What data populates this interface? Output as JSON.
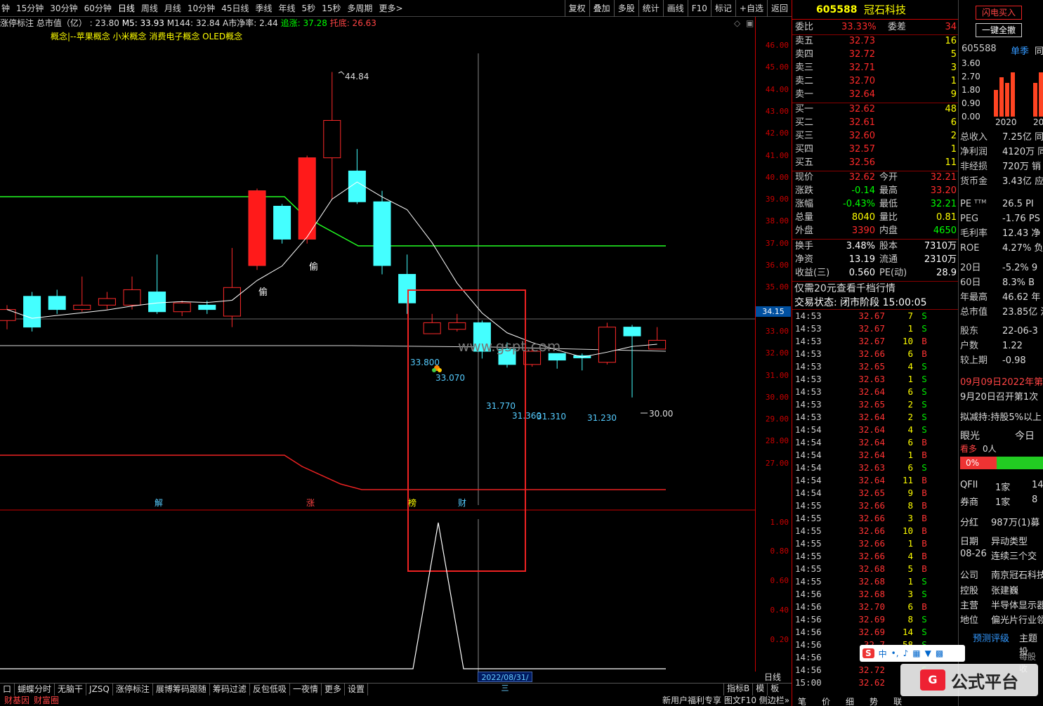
{
  "toolbar": {
    "periods": [
      "钟",
      "15分钟",
      "30分钟",
      "60分钟",
      "日线",
      "周线",
      "月线",
      "10分钟",
      "45日线",
      "季线",
      "年线",
      "5秒",
      "15秒",
      "多周期",
      "更多>"
    ],
    "tools": [
      "复权",
      "叠加",
      "多股",
      "统计",
      "画线",
      "F10",
      "标记",
      "+自选",
      "返回"
    ]
  },
  "info": {
    "label": "涨停标注 总市值（亿）",
    "mktcap": ": 23.80",
    "m5": "M5: 33.93",
    "m144": "M144: 32.84",
    "anet": "A市净率: 2.44",
    "zhui": "追涨: 37.28",
    "tuo": "托底: 26.63"
  },
  "concept": "概念|--苹果概念 小米概念 消费电子概念 OLED概念",
  "main_labels": {
    "high": "44.84",
    "l1": "33.800",
    "l2": "33.070",
    "l3": "31.770",
    "l4": "31.360",
    "l5": "31.310",
    "l6": "31.230",
    "low": "30.00",
    "tou1": "偷",
    "tou2": "偷",
    "jie": "解",
    "zhang": "涨",
    "bang": "榜",
    "cai": "财",
    "watermark": "www.gspt.com",
    "date": "2022/08/31/三",
    "cur_price": "34.15"
  },
  "yaxis_main": [
    "46.00",
    "45.00",
    "44.00",
    "43.00",
    "42.00",
    "41.00",
    "40.00",
    "39.00",
    "38.00",
    "37.00",
    "36.00",
    "35.00",
    "34.00",
    "33.00",
    "32.00",
    "31.00",
    "30.00",
    "29.00",
    "28.00",
    "27.00"
  ],
  "yaxis_sub": [
    "1.00",
    "0.80",
    "0.60",
    "0.40",
    "0.20"
  ],
  "chart_data": {
    "type": "candlestick",
    "candles": [
      {
        "o": 33.5,
        "c": 34.0,
        "h": 34.2,
        "l": 33.1
      },
      {
        "o": 34.6,
        "c": 33.2,
        "h": 34.8,
        "l": 33.0
      },
      {
        "o": 34.6,
        "c": 34.0,
        "h": 34.9,
        "l": 33.8
      },
      {
        "o": 34.0,
        "c": 34.2,
        "h": 35.5,
        "l": 33.9
      },
      {
        "o": 34.2,
        "c": 34.5,
        "h": 34.8,
        "l": 34.0
      },
      {
        "o": 34.2,
        "c": 34.9,
        "h": 35.5,
        "l": 34.0
      },
      {
        "o": 34.8,
        "c": 33.9,
        "h": 36.5,
        "l": 33.8
      },
      {
        "o": 33.9,
        "c": 34.3,
        "h": 34.4,
        "l": 33.7
      },
      {
        "o": 34.2,
        "c": 34.0,
        "h": 34.4,
        "l": 33.8
      },
      {
        "o": 33.7,
        "c": 35.0,
        "h": 36.8,
        "l": 33.2
      },
      {
        "o": 36.0,
        "c": 39.4,
        "h": 39.5,
        "l": 35.8
      },
      {
        "o": 38.7,
        "c": 37.2,
        "h": 38.8,
        "l": 37.0
      },
      {
        "o": 37.2,
        "c": 40.9,
        "h": 41.0,
        "l": 37.0
      },
      {
        "o": 40.9,
        "c": 42.6,
        "h": 44.8,
        "l": 39.0
      },
      {
        "o": 40.3,
        "c": 38.9,
        "h": 41.3,
        "l": 38.8
      },
      {
        "o": 38.9,
        "c": 36.0,
        "h": 39.4,
        "l": 35.6
      },
      {
        "o": 35.6,
        "c": 34.3,
        "h": 36.5,
        "l": 33.8
      },
      {
        "o": 32.9,
        "c": 33.4,
        "h": 33.8,
        "l": 33.07
      },
      {
        "o": 33.1,
        "c": 33.4,
        "h": 33.8,
        "l": 33.0
      },
      {
        "o": 33.4,
        "c": 32.1,
        "h": 33.5,
        "l": 31.77
      },
      {
        "o": 32.2,
        "c": 31.5,
        "h": 32.5,
        "l": 31.36
      },
      {
        "o": 31.5,
        "c": 32.1,
        "h": 32.3,
        "l": 31.4
      },
      {
        "o": 32.0,
        "c": 31.7,
        "h": 32.0,
        "l": 31.31
      },
      {
        "o": 31.9,
        "c": 31.8,
        "h": 32.0,
        "l": 31.23
      },
      {
        "o": 31.6,
        "c": 33.2,
        "h": 33.4,
        "l": 31.5
      },
      {
        "o": 33.2,
        "c": 32.8,
        "h": 33.3,
        "l": 30.0
      },
      {
        "o": 32.2,
        "c": 32.6,
        "h": 33.2,
        "l": 32.2
      }
    ]
  },
  "stock": {
    "code": "605588",
    "name": "冠石科技"
  },
  "book": {
    "weibi_label": "委比",
    "weibi": "33.33%",
    "weicha_label": "委差",
    "weicha": "34",
    "sells": [
      {
        "k": "卖五",
        "p": "32.73",
        "v": "16"
      },
      {
        "k": "卖四",
        "p": "32.72",
        "v": "5"
      },
      {
        "k": "卖三",
        "p": "32.71",
        "v": "3"
      },
      {
        "k": "卖二",
        "p": "32.70",
        "v": "1"
      },
      {
        "k": "卖一",
        "p": "32.64",
        "v": "9"
      }
    ],
    "buys": [
      {
        "k": "买一",
        "p": "32.62",
        "v": "48"
      },
      {
        "k": "买二",
        "p": "32.61",
        "v": "6"
      },
      {
        "k": "买三",
        "p": "32.60",
        "v": "2"
      },
      {
        "k": "买四",
        "p": "32.57",
        "v": "1"
      },
      {
        "k": "买五",
        "p": "32.56",
        "v": "11"
      }
    ]
  },
  "quote": [
    {
      "k": "现价",
      "v": "32.62",
      "k2": "今开",
      "v2": "32.21"
    },
    {
      "k": "涨跌",
      "v": "-0.14",
      "k2": "最高",
      "v2": "33.20"
    },
    {
      "k": "涨幅",
      "v": "-0.43%",
      "k2": "最低",
      "v2": "32.21"
    },
    {
      "k": "总量",
      "v": "8040",
      "k2": "量比",
      "v2": "0.81"
    },
    {
      "k": "外盘",
      "v": "3390",
      "k2": "内盘",
      "v2": "4650"
    },
    {
      "k": "换手",
      "v": "3.48%",
      "k2": "股本",
      "v2": "7310万"
    },
    {
      "k": "净资",
      "v": "13.19",
      "k2": "流通",
      "v2": "2310万"
    },
    {
      "k": "收益(三)",
      "v": "0.560",
      "k2": "PE(动)",
      "v2": "28.9"
    }
  ],
  "promo": "仅需20元查看千档行情",
  "status": "交易状态: 闭市阶段 15:00:05",
  "ticks": [
    [
      "14:53",
      "32.67",
      "7",
      "S"
    ],
    [
      "14:53",
      "32.67",
      "1",
      "S"
    ],
    [
      "14:53",
      "32.67",
      "10",
      "B"
    ],
    [
      "14:53",
      "32.66",
      "6",
      "B"
    ],
    [
      "14:53",
      "32.65",
      "4",
      "S"
    ],
    [
      "14:53",
      "32.63",
      "1",
      "S"
    ],
    [
      "14:53",
      "32.64",
      "6",
      "S"
    ],
    [
      "14:53",
      "32.65",
      "2",
      "S"
    ],
    [
      "14:53",
      "32.64",
      "2",
      "S"
    ],
    [
      "14:54",
      "32.64",
      "4",
      "S"
    ],
    [
      "14:54",
      "32.64",
      "6",
      "B"
    ],
    [
      "14:54",
      "32.64",
      "1",
      "B"
    ],
    [
      "14:54",
      "32.63",
      "6",
      "S"
    ],
    [
      "14:54",
      "32.64",
      "11",
      "B"
    ],
    [
      "14:54",
      "32.65",
      "9",
      "B"
    ],
    [
      "14:55",
      "32.66",
      "8",
      "B"
    ],
    [
      "14:55",
      "32.66",
      "3",
      "B"
    ],
    [
      "14:55",
      "32.66",
      "10",
      "B"
    ],
    [
      "14:55",
      "32.66",
      "1",
      "B"
    ],
    [
      "14:55",
      "32.66",
      "4",
      "B"
    ],
    [
      "14:55",
      "32.68",
      "5",
      "B"
    ],
    [
      "14:55",
      "32.68",
      "1",
      "S"
    ],
    [
      "14:56",
      "32.68",
      "3",
      "S"
    ],
    [
      "14:56",
      "32.70",
      "6",
      "B"
    ],
    [
      "14:56",
      "32.69",
      "8",
      "S"
    ],
    [
      "14:56",
      "32.69",
      "14",
      "S"
    ],
    [
      "14:56",
      "32.7",
      "58",
      "S"
    ],
    [
      "14:56",
      "32.7",
      "1",
      "S"
    ],
    [
      "14:56",
      "32.72",
      "",
      "S"
    ],
    [
      "15:00",
      "32.62",
      "",
      ""
    ]
  ],
  "fund": {
    "btn1": "闪电买入",
    "btn2": "一键全撤",
    "code": "605588",
    "tab": "单季",
    "tab2": "同",
    "yvals": [
      "3.60",
      "2.70",
      "1.80",
      "0.90",
      "0.00"
    ],
    "years": [
      "2020",
      "20"
    ],
    "rows": [
      {
        "k": "总收入",
        "v": "7.25亿 同"
      },
      {
        "k": "净利润",
        "v": "4120万 同"
      },
      {
        "k": "非经损",
        "v": "720万 销"
      },
      {
        "k": "货币金",
        "v": "3.43亿 应"
      }
    ],
    "rows2": [
      {
        "k": "PE ᵀᵀᴹ",
        "v": "26.5 PI"
      },
      {
        "k": "PEG",
        "v": "-1.76 PS"
      },
      {
        "k": "毛利率",
        "v": "12.43 净"
      },
      {
        "k": "ROE",
        "v": "4.27% 负"
      }
    ],
    "rows3": [
      {
        "k": "20日",
        "v": "-5.2% 9"
      },
      {
        "k": "60日",
        "v": "8.3% B"
      },
      {
        "k": "年最高",
        "v": "46.62 年"
      },
      {
        "k": "总市值",
        "v": "23.85亿 流"
      }
    ],
    "rows4": [
      {
        "k": "股东",
        "v": "22-06-3"
      },
      {
        "k": "户数",
        "v": "1.22"
      },
      {
        "k": "较上期",
        "v": "-0.98"
      }
    ],
    "news1": "09月09日2022年第",
    "news2": "9月20日召开第1次",
    "news3": "拟减持:持股5%以上",
    "yan": "眼光",
    "today": "今日",
    "kanduo": "看多",
    "ren": "0人",
    "pct": "0%",
    "qfii": "QFII",
    "qv": "1家",
    "qv2": "14",
    "qs": "券商",
    "qsv": "1家",
    "qsv2": "8",
    "fh": "分红",
    "fhv": "987万(1)募",
    "rq": "日期",
    "yd": "异动类型",
    "d1": "08-26",
    "d1v": "连续三个交",
    "gs": "公司",
    "gsv": "南京冠石科技",
    "kg": "控股",
    "kgv": "张建巍",
    "zy": "主营",
    "zyv": "半导体显示器",
    "dw": "地位",
    "dwv": "偏光片行业领",
    "yc": "预测评级",
    "zt": "主题投",
    "mg": "每股收"
  },
  "bottom": {
    "tabs": [
      "口",
      "蝴蝶分时",
      "无脑干",
      "JZSQ",
      "涨停标注",
      "展博筹码跟随",
      "筹码过滤",
      "反包低吸",
      "一夜情",
      "更多",
      "设置"
    ],
    "right": [
      "指标B",
      "模",
      "板"
    ],
    "line": "日线",
    "tabs2": [
      "财基因",
      "财富圈"
    ],
    "promo": "新用户福利专享 图文F10 侧边栏»",
    "rtabs": [
      "笔",
      "价",
      "细",
      "势",
      "联"
    ],
    "logo": "公式平台"
  }
}
